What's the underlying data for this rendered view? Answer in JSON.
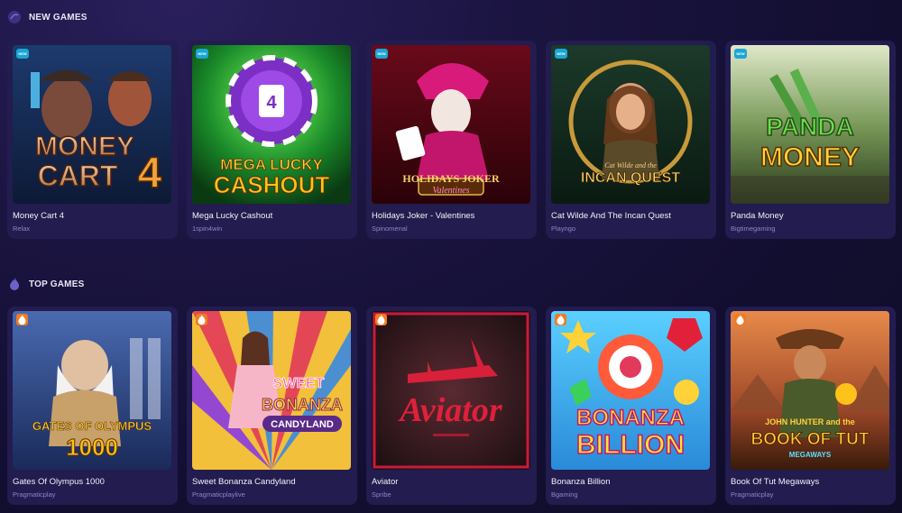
{
  "new_games": {
    "title": "NEW GAMES",
    "icon": "swirl-icon",
    "badge": "NEW",
    "games": [
      {
        "name": "Money Cart 4",
        "provider": "Relax",
        "art_line1": "MONEY",
        "art_line2": "CART",
        "art_num": "4"
      },
      {
        "name": "Mega Lucky Cashout",
        "provider": "1spin4win",
        "art_line1": "MEGA LUCKY",
        "art_line2": "CASHOUT"
      },
      {
        "name": "Holidays Joker - Valentines",
        "provider": "Spinomenal",
        "art_line1": "HOLIDAYS JOKER",
        "art_line2": "Valentines"
      },
      {
        "name": "Cat Wilde And The Incan Quest",
        "provider": "Playngo",
        "art_line1": "Cat Wilde and the",
        "art_line2": "INCAN QUEST"
      },
      {
        "name": "Panda Money",
        "provider": "Bigtimegaming",
        "art_line1": "PANDA",
        "art_line2": "MONEY"
      }
    ]
  },
  "top_games": {
    "title": "TOP GAMES",
    "icon": "flame-icon",
    "games": [
      {
        "name": "Gates Of Olympus 1000",
        "provider": "Pragmaticplay",
        "art_line1": "GATES OF OLYMPUS",
        "art_line2": "1000"
      },
      {
        "name": "Sweet Bonanza Candyland",
        "provider": "Pragmaticplaylive",
        "art_line1": "SWEET",
        "art_line2": "BONANZA",
        "art_line3": "CANDYLAND"
      },
      {
        "name": "Aviator",
        "provider": "Spribe",
        "art_line1": "Aviator"
      },
      {
        "name": "Bonanza Billion",
        "provider": "Bgaming",
        "art_line1": "BONANZA",
        "art_line2": "BILLION"
      },
      {
        "name": "Book Of Tut Megaways",
        "provider": "Pragmaticplay",
        "art_line1": "JOHN HUNTER and the",
        "art_line2": "BOOK OF TUT",
        "art_line3": "MEGAWAYS"
      }
    ]
  },
  "colors": {
    "background": "#120e30",
    "card": "#221c4f",
    "provider_text": "#8f86c8",
    "new_badge": "#1aa6d6",
    "fire_badge": "#f07a23"
  }
}
